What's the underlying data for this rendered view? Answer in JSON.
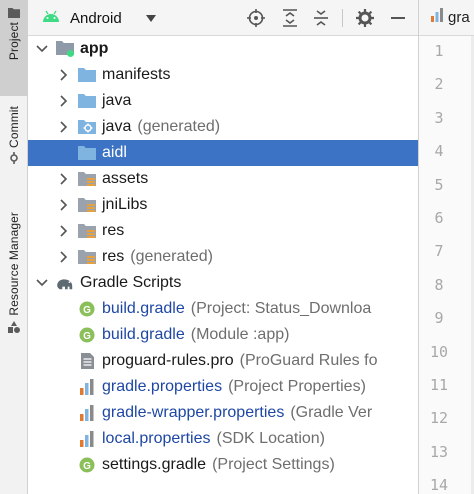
{
  "colors": {
    "accent": "#3d73c4",
    "folder_blue": "#7fb3e0",
    "gradle_green": "#8bbf5a",
    "android_green": "#3ddc84",
    "link_blue": "#1e47a3"
  },
  "side_strip": {
    "tabs": [
      {
        "label": "Project",
        "icon": "folder-icon",
        "active": true
      },
      {
        "label": "Commit",
        "icon": "commit-icon",
        "active": false
      },
      {
        "label": "Resource Manager",
        "icon": "resource-manager-icon",
        "active": false
      }
    ]
  },
  "toolbar": {
    "view_label": "Android",
    "icons": [
      "locate-icon",
      "expand-all-icon",
      "collapse-all-icon",
      "settings-icon",
      "hide-icon"
    ]
  },
  "tree": [
    {
      "level": 0,
      "chevron": "down",
      "icon": "module-folder-icon",
      "name": "app",
      "hint": "",
      "bold": true
    },
    {
      "level": 1,
      "chevron": "right",
      "icon": "folder-icon",
      "name": "manifests",
      "hint": ""
    },
    {
      "level": 1,
      "chevron": "right",
      "icon": "folder-icon",
      "name": "java",
      "hint": ""
    },
    {
      "level": 1,
      "chevron": "right",
      "icon": "generated-folder-icon",
      "name": "java",
      "hint": "(generated)"
    },
    {
      "level": 1,
      "chevron": "none",
      "icon": "folder-icon",
      "name": "aidl",
      "hint": "",
      "selected": true
    },
    {
      "level": 1,
      "chevron": "right",
      "icon": "resource-folder-icon",
      "name": "assets",
      "hint": ""
    },
    {
      "level": 1,
      "chevron": "right",
      "icon": "resource-folder-icon",
      "name": "jniLibs",
      "hint": ""
    },
    {
      "level": 1,
      "chevron": "right",
      "icon": "resource-folder-icon",
      "name": "res",
      "hint": ""
    },
    {
      "level": 1,
      "chevron": "right",
      "icon": "resource-folder-icon",
      "name": "res",
      "hint": "(generated)"
    },
    {
      "level": 0,
      "chevron": "down",
      "icon": "gradle-elephant-icon",
      "name": "Gradle Scripts",
      "hint": ""
    },
    {
      "level": 1,
      "chevron": "none",
      "icon": "gradle-file-icon",
      "name": "build.gradle",
      "hint": "(Project: Status_Downloa",
      "link": true
    },
    {
      "level": 1,
      "chevron": "none",
      "icon": "gradle-file-icon",
      "name": "build.gradle",
      "hint": "(Module :app)",
      "link": true
    },
    {
      "level": 1,
      "chevron": "none",
      "icon": "text-file-icon",
      "name": "proguard-rules.pro",
      "hint": "(ProGuard Rules fo"
    },
    {
      "level": 1,
      "chevron": "none",
      "icon": "properties-file-icon",
      "name": "gradle.properties",
      "hint": "(Project Properties)",
      "link": true
    },
    {
      "level": 1,
      "chevron": "none",
      "icon": "properties-file-icon",
      "name": "gradle-wrapper.properties",
      "hint": "(Gradle Ver",
      "link": true
    },
    {
      "level": 1,
      "chevron": "none",
      "icon": "properties-file-icon",
      "name": "local.properties",
      "hint": "(SDK Location)",
      "link": true
    },
    {
      "level": 1,
      "chevron": "none",
      "icon": "gradle-file-icon",
      "name": "settings.gradle",
      "hint": "(Project Settings)"
    }
  ],
  "editor": {
    "tab_label": "gra",
    "tab_icon": "properties-file-icon",
    "line_numbers": [
      "1",
      "2",
      "3",
      "4",
      "5",
      "6",
      "7",
      "8",
      "9",
      "10",
      "11",
      "12",
      "13",
      "14"
    ]
  }
}
